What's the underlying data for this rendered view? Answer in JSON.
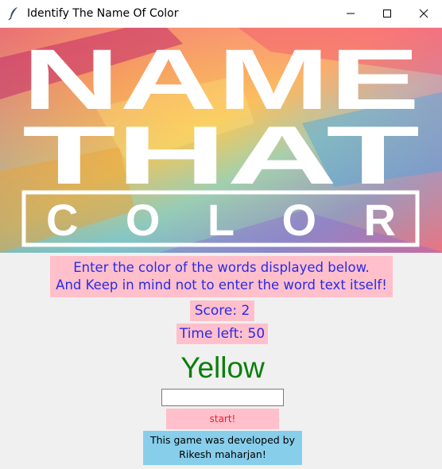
{
  "window": {
    "title": "Identify The Name Of Color",
    "app_icon": "feather-icon",
    "controls": [
      "minimize-icon",
      "maximize-icon",
      "close-icon"
    ]
  },
  "banner": {
    "lines": [
      "NAME",
      "THAT",
      "COLOR"
    ]
  },
  "game": {
    "instructions_line1": "Enter the color of the words displayed below.",
    "instructions_line2": "And Keep in mind not to enter the word text itself!",
    "score": "Score: 2",
    "time_left": "Time left: 50",
    "color_word": "Yellow",
    "color_word_color": "#0a7f0a",
    "entry_value": "",
    "start_label": "start!",
    "credit_line1": "This game was developed by",
    "credit_line2": "Rikesh maharjan!"
  },
  "colors": {
    "label_bg": "#ffc0cb",
    "label_text": "#2a2ae8",
    "start_text": "#e8202a",
    "credit_bg": "#87ceeb"
  }
}
